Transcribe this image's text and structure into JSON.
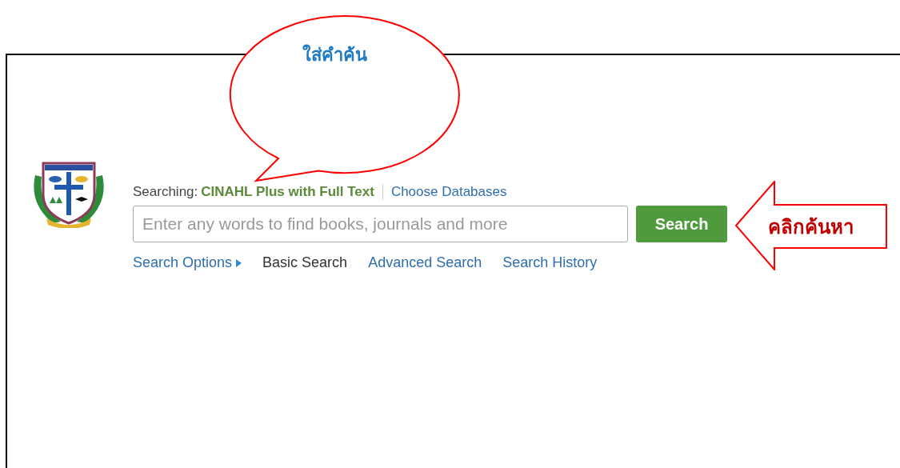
{
  "search": {
    "searching_label": "Searching:",
    "database": "CINAHL Plus with Full Text",
    "choose_link": "Choose Databases",
    "placeholder": "Enter any words to find books, journals and more",
    "button": "Search",
    "links": [
      {
        "label": "Search Options",
        "kind": "toggle",
        "selected": false
      },
      {
        "label": "Basic Search",
        "kind": "mode",
        "selected": true
      },
      {
        "label": "Advanced Search",
        "kind": "mode",
        "selected": false
      },
      {
        "label": "Search History",
        "kind": "mode",
        "selected": false
      }
    ]
  },
  "annotations": {
    "bubble": "ใส่คำค้น",
    "arrow": "คลิกค้นหา"
  }
}
